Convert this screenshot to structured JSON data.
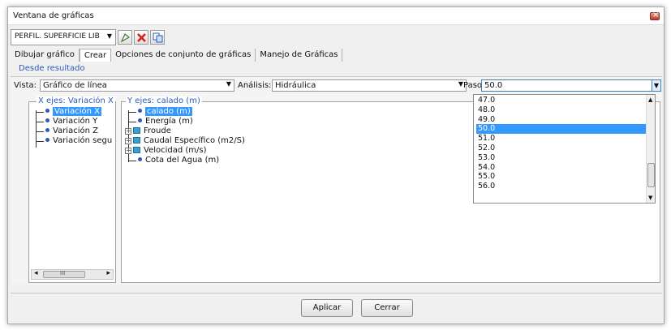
{
  "window": {
    "title": "Ventana de gráficas"
  },
  "toolbar": {
    "profile_combo": "PERFIL. SUPERFICIE LIB"
  },
  "tabs": [
    {
      "label": "Dibujar gráfico"
    },
    {
      "label": "Crear"
    },
    {
      "label": "Opciones de conjunto de gráficas"
    },
    {
      "label": "Manejo de Gráficas"
    }
  ],
  "sublink": "Desde resultado",
  "controls": {
    "vista_label": "Vista:",
    "vista_value": "Gráfico de línea",
    "analisis_label": "Análisis:",
    "analisis_value": "Hidráulica",
    "paso_label": "Paso:",
    "paso_value": "50.0"
  },
  "x_axis_panel": {
    "title": "X ejes: Variación X",
    "items": [
      "Variación X",
      "Variación Y",
      "Variación Z",
      "Variación segu"
    ]
  },
  "y_axis_panel": {
    "title": "Y ejes: calado (m)",
    "items": [
      "calado (m)",
      "Energía (m)",
      "Froude",
      "Caudal Específico (m2/S)",
      "Velocidad (m/s)",
      "Cota del Agua (m)"
    ]
  },
  "paso_options": [
    "47.0",
    "48.0",
    "49.0",
    "50.0",
    "51.0",
    "52.0",
    "53.0",
    "54.0",
    "55.0",
    "56.0"
  ],
  "paso_selected": "50.0",
  "buttons": {
    "apply": "Aplicar",
    "close": "Cerrar"
  },
  "scroll_glyph": "III"
}
